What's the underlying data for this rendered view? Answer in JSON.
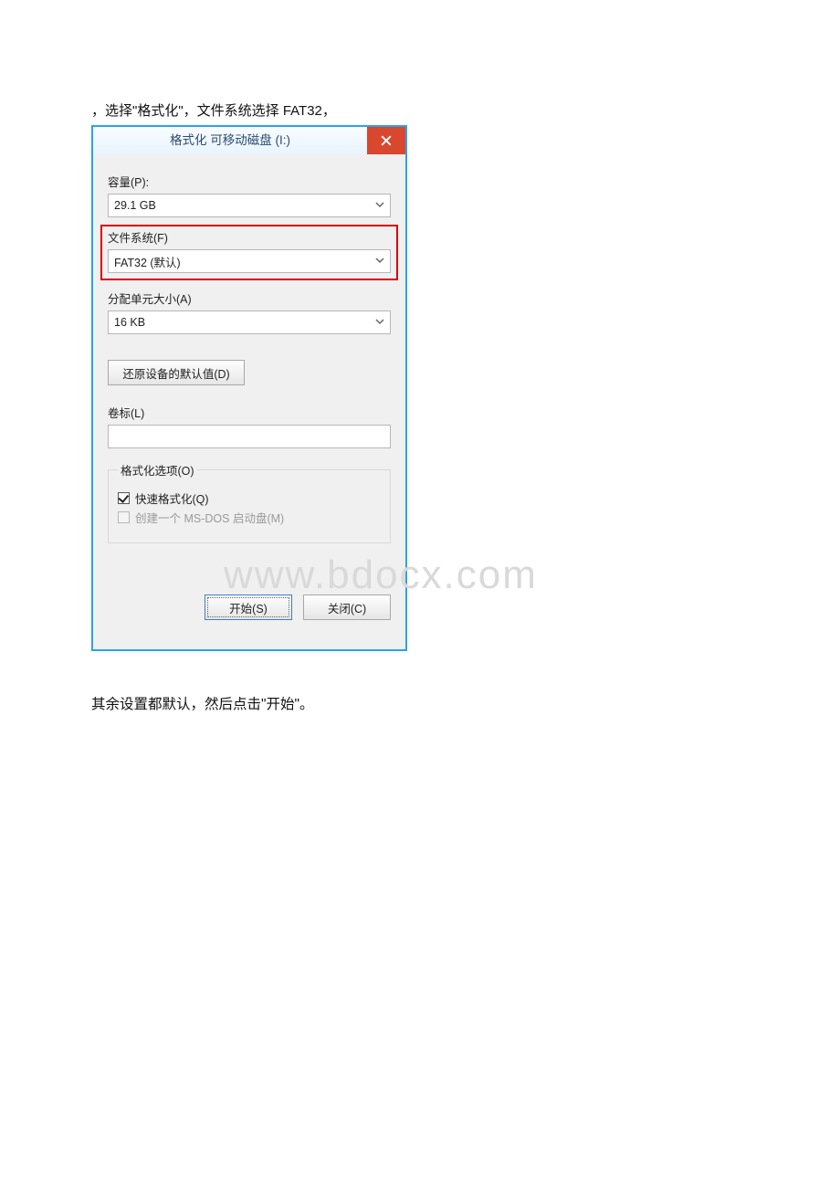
{
  "intro": "，选择\"格式化\"，文件系统选择 FAT32，",
  "dialog": {
    "title": "格式化 可移动磁盘 (I:)",
    "capacity_label": "容量(P):",
    "capacity_value": "29.1 GB",
    "filesystem_label": "文件系统(F)",
    "filesystem_value": "FAT32 (默认)",
    "alloc_label": "分配单元大小(A)",
    "alloc_value": "16 KB",
    "restore_defaults": "还原设备的默认值(D)",
    "volume_label": "卷标(L)",
    "options_legend": "格式化选项(O)",
    "quick_format": "快速格式化(Q)",
    "msdos_boot": "创建一个 MS-DOS 启动盘(M)",
    "start_btn": "开始(S)",
    "close_btn": "关闭(C)"
  },
  "watermark": "www.bdocx.com",
  "after": "其余设置都默认，然后点击\"开始\"。"
}
